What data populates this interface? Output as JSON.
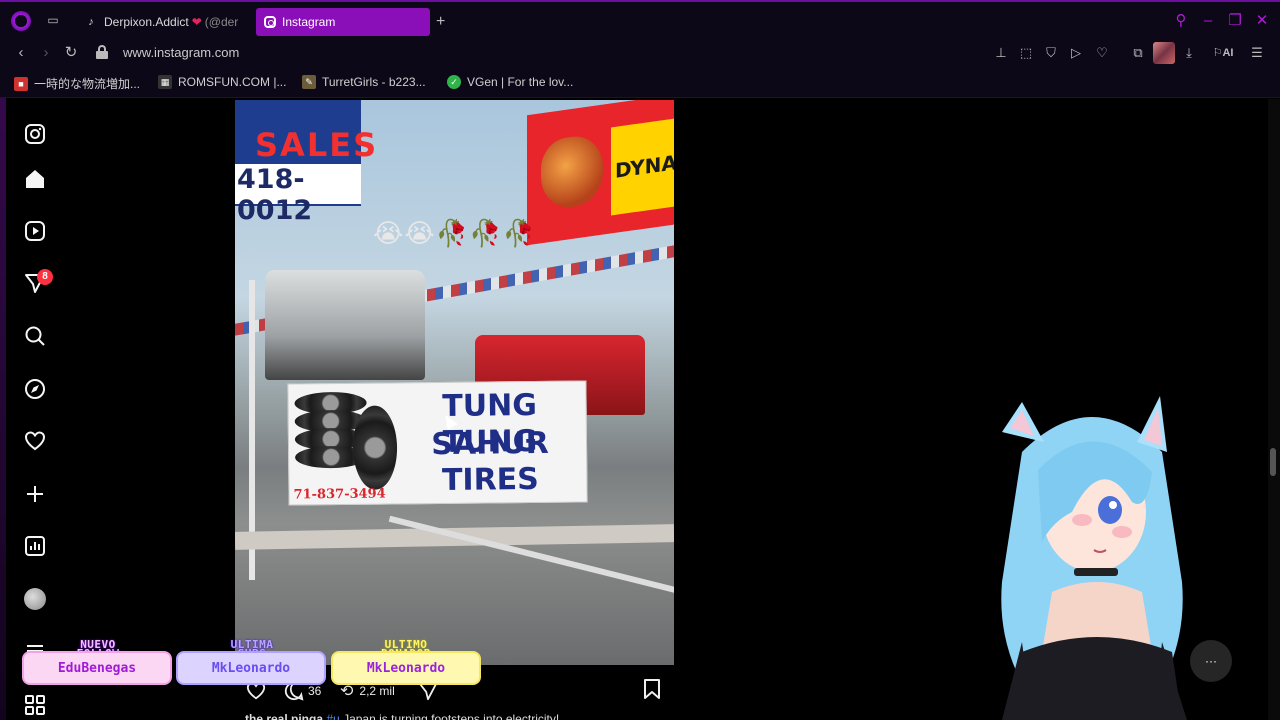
{
  "browser": {
    "tabs": [
      {
        "title": "Derpixon.Addict",
        "suffix": "(@der"
      },
      {
        "title": "Instagram"
      }
    ],
    "url": "www.instagram.com",
    "ai_label": "AI",
    "bookmarks": [
      {
        "label": "一時的な物流増加..."
      },
      {
        "label": "ROMSFUN.COM |..."
      },
      {
        "label": "TurretGirls - b223..."
      },
      {
        "label": "VGen | For the lov..."
      }
    ]
  },
  "sidebar": {
    "notification_count": "8"
  },
  "post": {
    "image": {
      "sign_sales": "SALES",
      "sign_phone_partial": "418-0012",
      "billboard_text": "DYNAM",
      "emoji": "😭😭🥀🥀🥀",
      "tire_sign_lines": [
        "TUNG TUNG",
        "SAHUR",
        "TIRES"
      ],
      "tire_sign_phone": "71-837-3494"
    },
    "comments_count": "36",
    "reposts_count": "2,2 mil",
    "caption_user": "the.real.pinga",
    "caption_tag": "#u",
    "caption_text": "Japan is turning footsteps into electricity!"
  },
  "stream_overlay": {
    "chips": [
      {
        "title": "NUEVO FOLLOW",
        "name": "EduBenegas"
      },
      {
        "title": "ULTIMA SUBS",
        "name": "MkLeonardo"
      },
      {
        "title": "ULTIMO DONADOR",
        "name": "MkLeonardo"
      }
    ]
  },
  "colors": {
    "accent": "#8b0fb8",
    "badge": "#ff3040",
    "link": "#4a8cff"
  }
}
